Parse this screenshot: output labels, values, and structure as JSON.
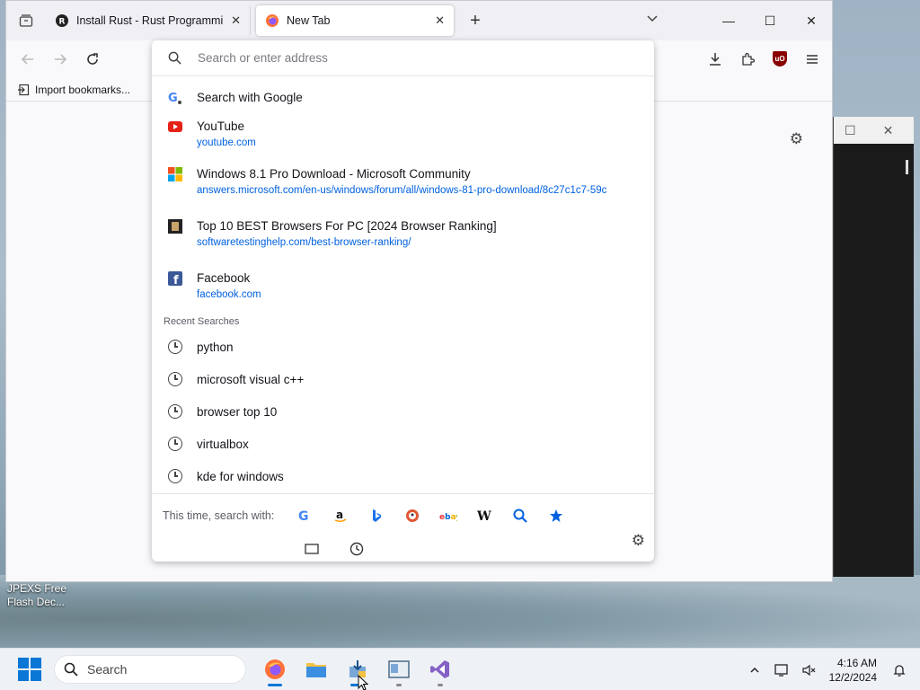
{
  "browser": {
    "tabs": [
      {
        "label": "Install Rust - Rust Programming",
        "active": false
      },
      {
        "label": "New Tab",
        "active": true
      }
    ],
    "toolbar": {
      "import_bookmarks": "Import bookmarks..."
    }
  },
  "urlbar": {
    "placeholder": "Search or enter address",
    "first_result": "Search with Google",
    "results": [
      {
        "title": "YouTube",
        "url": "youtube.com",
        "icon": "youtube-icon"
      },
      {
        "title": "Windows 8.1 Pro Download - Microsoft Community",
        "url": "answers.microsoft.com/en-us/windows/forum/all/windows-81-pro-download/8c27c1c7-59c",
        "icon": "microsoft-icon"
      },
      {
        "title": "Top 10 BEST Browsers For PC [2024 Browser Ranking]",
        "url": "softwaretestinghelp.com/best-browser-ranking/",
        "icon": "sth-icon"
      },
      {
        "title": "Facebook",
        "url": "facebook.com",
        "icon": "facebook-icon"
      }
    ],
    "recent_label": "Recent Searches",
    "recent_searches": [
      "python",
      "microsoft visual c++",
      "browser top 10",
      "virtualbox",
      "kde for windows"
    ],
    "search_with_label": "This time, search with:",
    "engines": [
      "google",
      "amazon",
      "bing",
      "duckduckgo",
      "ebay",
      "wikipedia",
      "search",
      "bookmarks"
    ]
  },
  "desktop": {
    "icon_label": "JPEXS Free Flash Dec..."
  },
  "taskbar": {
    "search_label": "Search",
    "time": "4:16 AM",
    "date": "12/2/2024"
  },
  "colors": {
    "accent": "#0061e0",
    "taskbar_accent": "#0a76d6"
  }
}
